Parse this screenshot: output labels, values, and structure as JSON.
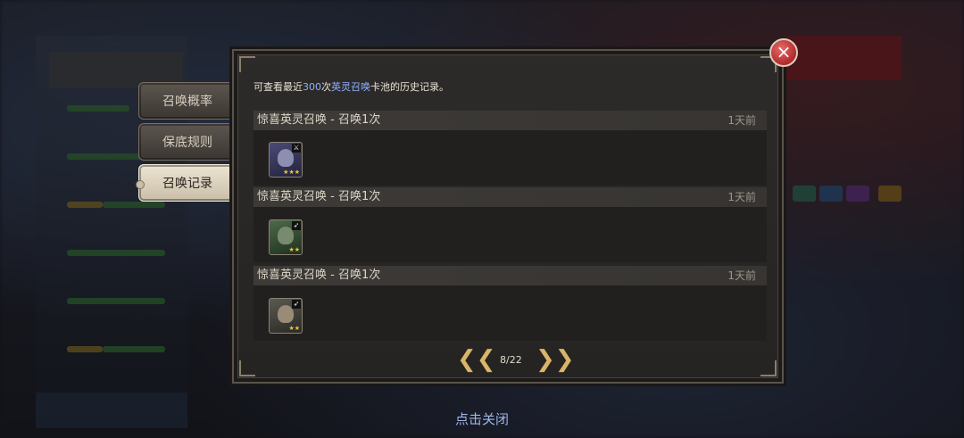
{
  "tabs": [
    {
      "label": "召唤概率",
      "active": false
    },
    {
      "label": "保底规则",
      "active": false
    },
    {
      "label": "召唤记录",
      "active": true
    }
  ],
  "notice": {
    "prefix": "可查看最近",
    "count": "300",
    "mid": "次",
    "pool": "英灵召唤",
    "suffix": "卡池的历史记录。"
  },
  "records": [
    {
      "title": "惊喜英灵召唤 - 召唤1次",
      "time": "1天前",
      "hero_icon": "hooded-mage-portrait-icon",
      "stars": "★★★"
    },
    {
      "title": "惊喜英灵召唤 - 召唤1次",
      "time": "1天前",
      "hero_icon": "green-hooded-archer-portrait-icon",
      "stars": "★★"
    },
    {
      "title": "惊喜英灵召唤 - 召唤1次",
      "time": "1天前",
      "hero_icon": "masked-rogue-portrait-icon",
      "stars": "★★"
    }
  ],
  "pager": {
    "page": "8/22",
    "prev": "❮❮",
    "next": "❯❯"
  },
  "close_icon": "×",
  "tap_close": "点击关闭",
  "colors": {
    "accent_blue": "#8fb0ff",
    "close_red": "#b02a2a",
    "pager_gold": "#d9b56a"
  }
}
